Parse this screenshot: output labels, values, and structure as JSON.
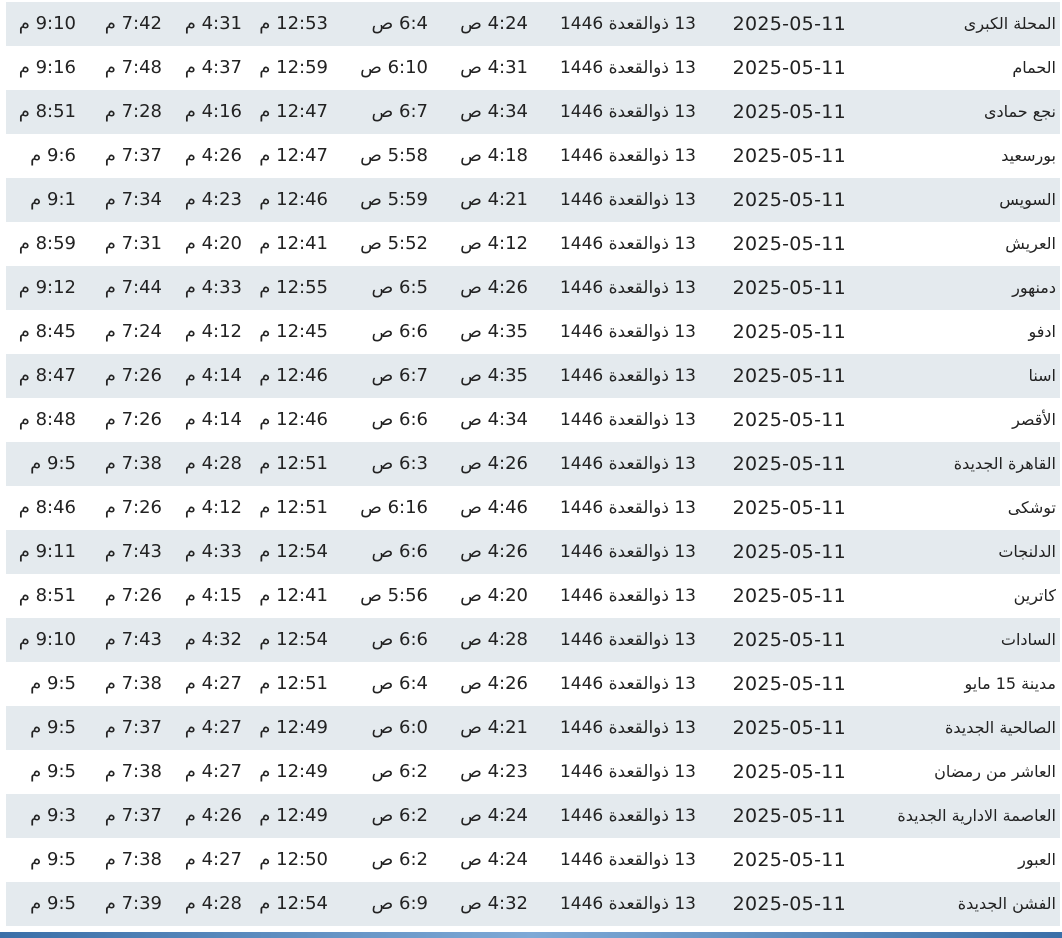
{
  "table": {
    "rows": [
      {
        "city": "المحلة الكبرى",
        "date": "2025-05-11",
        "hijri": "13 ذوالقعدة 1446",
        "fajr": "4:24 ص",
        "sunrise": "6:4 ص",
        "dhuhr": "12:53 م",
        "asr": "4:31 م",
        "maghrib": "7:42 م",
        "isha": "9:10 م"
      },
      {
        "city": "الحمام",
        "date": "2025-05-11",
        "hijri": "13 ذوالقعدة 1446",
        "fajr": "4:31 ص",
        "sunrise": "6:10 ص",
        "dhuhr": "12:59 م",
        "asr": "4:37 م",
        "maghrib": "7:48 م",
        "isha": "9:16 م"
      },
      {
        "city": "نجع حمادى",
        "date": "2025-05-11",
        "hijri": "13 ذوالقعدة 1446",
        "fajr": "4:34 ص",
        "sunrise": "6:7 ص",
        "dhuhr": "12:47 م",
        "asr": "4:16 م",
        "maghrib": "7:28 م",
        "isha": "8:51 م"
      },
      {
        "city": "بورسعيد",
        "date": "2025-05-11",
        "hijri": "13 ذوالقعدة 1446",
        "fajr": "4:18 ص",
        "sunrise": "5:58 ص",
        "dhuhr": "12:47 م",
        "asr": "4:26 م",
        "maghrib": "7:37 م",
        "isha": "9:6 م"
      },
      {
        "city": "السويس",
        "date": "2025-05-11",
        "hijri": "13 ذوالقعدة 1446",
        "fajr": "4:21 ص",
        "sunrise": "5:59 ص",
        "dhuhr": "12:46 م",
        "asr": "4:23 م",
        "maghrib": "7:34 م",
        "isha": "9:1 م"
      },
      {
        "city": "العريش",
        "date": "2025-05-11",
        "hijri": "13 ذوالقعدة 1446",
        "fajr": "4:12 ص",
        "sunrise": "5:52 ص",
        "dhuhr": "12:41 م",
        "asr": "4:20 م",
        "maghrib": "7:31 م",
        "isha": "8:59 م"
      },
      {
        "city": "دمنهور",
        "date": "2025-05-11",
        "hijri": "13 ذوالقعدة 1446",
        "fajr": "4:26 ص",
        "sunrise": "6:5 ص",
        "dhuhr": "12:55 م",
        "asr": "4:33 م",
        "maghrib": "7:44 م",
        "isha": "9:12 م"
      },
      {
        "city": "ادفو",
        "date": "2025-05-11",
        "hijri": "13 ذوالقعدة 1446",
        "fajr": "4:35 ص",
        "sunrise": "6:6 ص",
        "dhuhr": "12:45 م",
        "asr": "4:12 م",
        "maghrib": "7:24 م",
        "isha": "8:45 م"
      },
      {
        "city": "اسنا",
        "date": "2025-05-11",
        "hijri": "13 ذوالقعدة 1446",
        "fajr": "4:35 ص",
        "sunrise": "6:7 ص",
        "dhuhr": "12:46 م",
        "asr": "4:14 م",
        "maghrib": "7:26 م",
        "isha": "8:47 م"
      },
      {
        "city": "الأقصر",
        "date": "2025-05-11",
        "hijri": "13 ذوالقعدة 1446",
        "fajr": "4:34 ص",
        "sunrise": "6:6 ص",
        "dhuhr": "12:46 م",
        "asr": "4:14 م",
        "maghrib": "7:26 م",
        "isha": "8:48 م"
      },
      {
        "city": "القاهرة الجديدة",
        "date": "2025-05-11",
        "hijri": "13 ذوالقعدة 1446",
        "fajr": "4:26 ص",
        "sunrise": "6:3 ص",
        "dhuhr": "12:51 م",
        "asr": "4:28 م",
        "maghrib": "7:38 م",
        "isha": "9:5 م"
      },
      {
        "city": "توشكى",
        "date": "2025-05-11",
        "hijri": "13 ذوالقعدة 1446",
        "fajr": "4:46 ص",
        "sunrise": "6:16 ص",
        "dhuhr": "12:51 م",
        "asr": "4:12 م",
        "maghrib": "7:26 م",
        "isha": "8:46 م"
      },
      {
        "city": "الدلنجات",
        "date": "2025-05-11",
        "hijri": "13 ذوالقعدة 1446",
        "fajr": "4:26 ص",
        "sunrise": "6:6 ص",
        "dhuhr": "12:54 م",
        "asr": "4:33 م",
        "maghrib": "7:43 م",
        "isha": "9:11 م"
      },
      {
        "city": "كاترين",
        "date": "2025-05-11",
        "hijri": "13 ذوالقعدة 1446",
        "fajr": "4:20 ص",
        "sunrise": "5:56 ص",
        "dhuhr": "12:41 م",
        "asr": "4:15 م",
        "maghrib": "7:26 م",
        "isha": "8:51 م"
      },
      {
        "city": "السادات",
        "date": "2025-05-11",
        "hijri": "13 ذوالقعدة 1446",
        "fajr": "4:28 ص",
        "sunrise": "6:6 ص",
        "dhuhr": "12:54 م",
        "asr": "4:32 م",
        "maghrib": "7:43 م",
        "isha": "9:10 م"
      },
      {
        "city": "مدينة 15 مايو",
        "date": "2025-05-11",
        "hijri": "13 ذوالقعدة 1446",
        "fajr": "4:26 ص",
        "sunrise": "6:4 ص",
        "dhuhr": "12:51 م",
        "asr": "4:27 م",
        "maghrib": "7:38 م",
        "isha": "9:5 م"
      },
      {
        "city": "الصالحية الجديدة",
        "date": "2025-05-11",
        "hijri": "13 ذوالقعدة 1446",
        "fajr": "4:21 ص",
        "sunrise": "6:0 ص",
        "dhuhr": "12:49 م",
        "asr": "4:27 م",
        "maghrib": "7:37 م",
        "isha": "9:5 م"
      },
      {
        "city": "العاشر من رمضان",
        "date": "2025-05-11",
        "hijri": "13 ذوالقعدة 1446",
        "fajr": "4:23 ص",
        "sunrise": "6:2 ص",
        "dhuhr": "12:49 م",
        "asr": "4:27 م",
        "maghrib": "7:38 م",
        "isha": "9:5 م"
      },
      {
        "city": "العاصمة الادارية الجديدة",
        "date": "2025-05-11",
        "hijri": "13 ذوالقعدة 1446",
        "fajr": "4:24 ص",
        "sunrise": "6:2 ص",
        "dhuhr": "12:49 م",
        "asr": "4:26 م",
        "maghrib": "7:37 م",
        "isha": "9:3 م"
      },
      {
        "city": "العبور",
        "date": "2025-05-11",
        "hijri": "13 ذوالقعدة 1446",
        "fajr": "4:24 ص",
        "sunrise": "6:2 ص",
        "dhuhr": "12:50 م",
        "asr": "4:27 م",
        "maghrib": "7:38 م",
        "isha": "9:5 م"
      },
      {
        "city": "الفشن الجديدة",
        "date": "2025-05-11",
        "hijri": "13 ذوالقعدة 1446",
        "fajr": "4:32 ص",
        "sunrise": "6:9 ص",
        "dhuhr": "12:54 م",
        "asr": "4:28 م",
        "maghrib": "7:39 م",
        "isha": "9:5 م"
      }
    ]
  },
  "colors": {
    "stripe": "#e4eaee",
    "text": "#222222",
    "bottom_bar": "#3a6fa8"
  }
}
